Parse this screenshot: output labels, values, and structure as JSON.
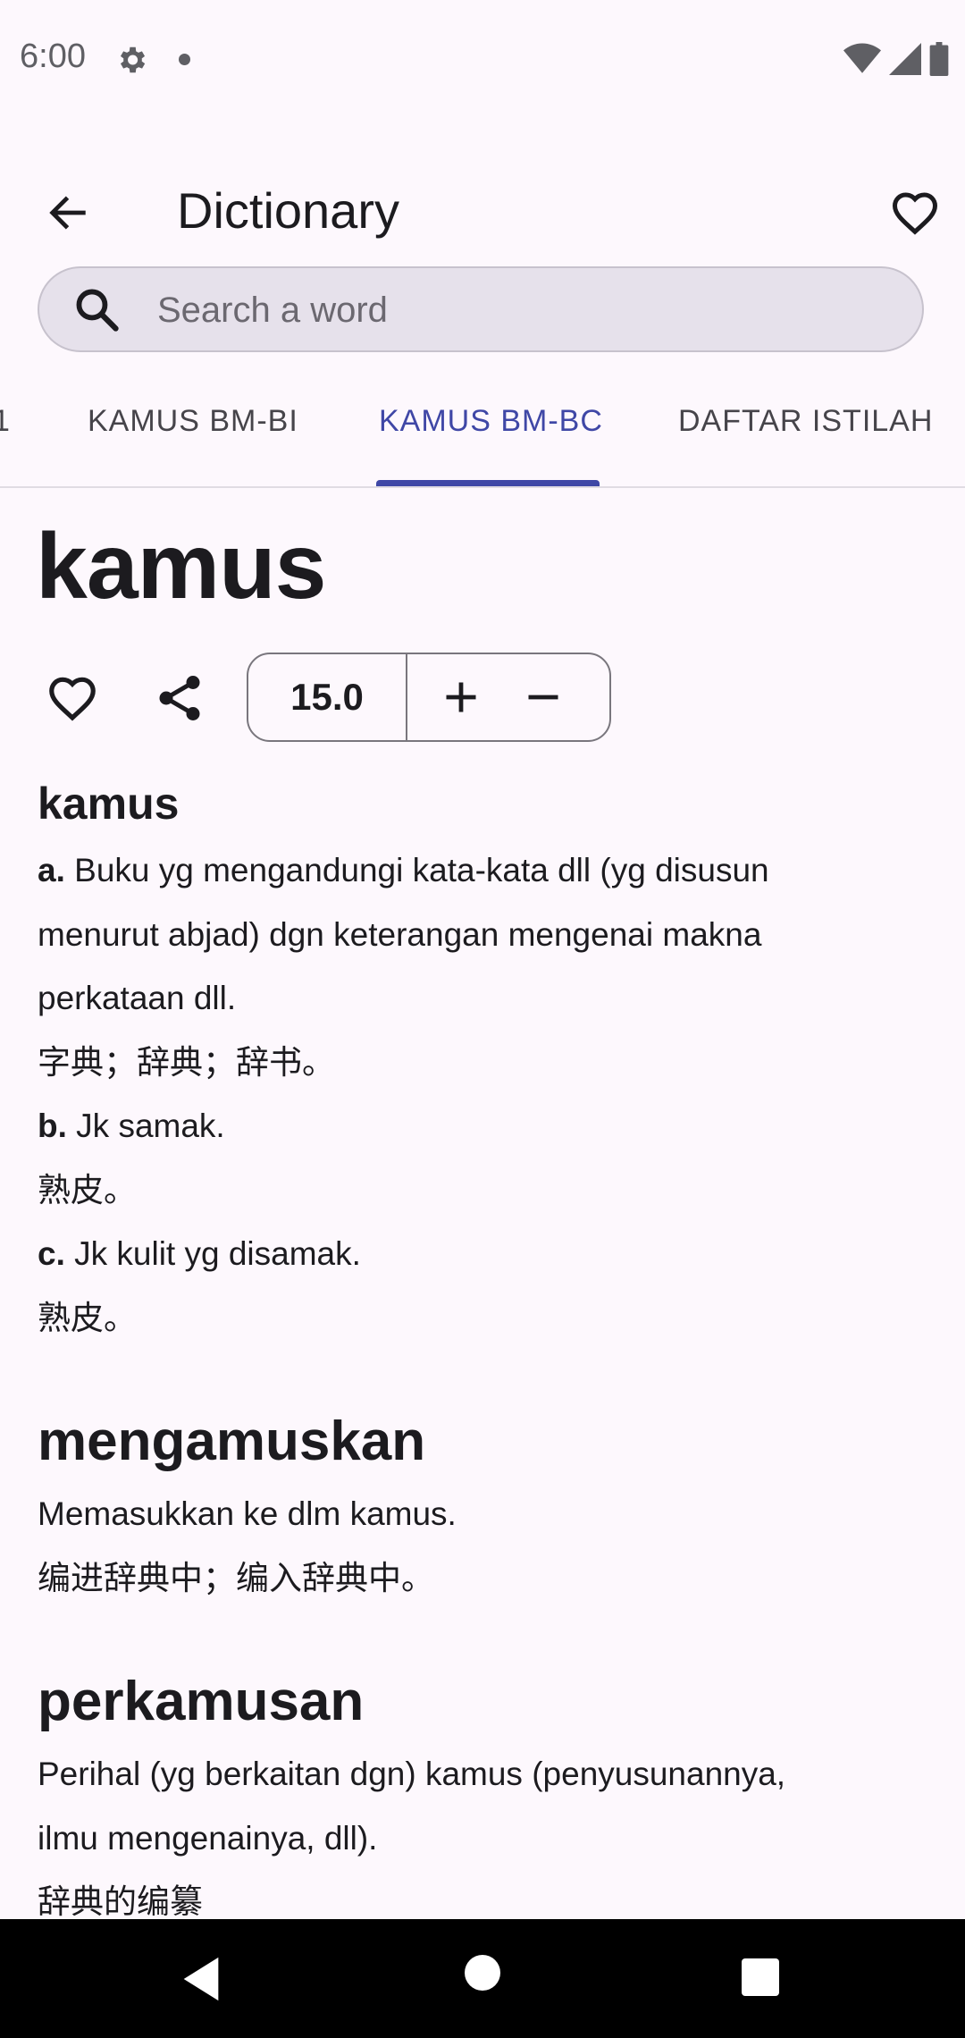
{
  "status_bar": {
    "time": "6:00"
  },
  "app_bar": {
    "title": "Dictionary"
  },
  "search": {
    "placeholder": "Search a word"
  },
  "tabs": [
    {
      "label": "KAMUS BM-BI",
      "active": false
    },
    {
      "label": "KAMUS BM-BC",
      "active": true
    },
    {
      "label": "DAFTAR ISTILAH",
      "active": false
    }
  ],
  "partial_tab_fragment": "1",
  "headword": "kamus",
  "font_size": "15.0",
  "entries": [
    {
      "title": "kamus",
      "lines": [
        {
          "marker": "a.",
          "text": " Buku yg mengandungi kata-kata dll (yg disusun"
        },
        {
          "marker": "",
          "text": "menurut abjad) dgn keterangan mengenai makna"
        },
        {
          "marker": "",
          "text": "perkataan dll."
        },
        {
          "marker": "",
          "text": "字典；辞典；辞书。"
        },
        {
          "marker": "b.",
          "text": " Jk samak."
        },
        {
          "marker": "",
          "text": "熟皮。"
        },
        {
          "marker": "c.",
          "text": " Jk kulit yg disamak."
        },
        {
          "marker": "",
          "text": "熟皮。"
        }
      ]
    },
    {
      "title": "mengamuskan",
      "lines": [
        {
          "marker": "",
          "text": "Memasukkan ke dlm kamus."
        },
        {
          "marker": "",
          "text": "编进辞典中；编入辞典中。"
        }
      ]
    },
    {
      "title": "perkamusan",
      "lines": [
        {
          "marker": "",
          "text": "Perihal (yg berkaitan dgn) kamus (penyusunannya,"
        },
        {
          "marker": "",
          "text": "ilmu mengenainya, dll)."
        },
        {
          "marker": "",
          "text": "辞典的编纂"
        }
      ]
    }
  ],
  "colors": {
    "accent": "#3F47A6",
    "background": "#FDF8FD",
    "search_bg": "#E6E1EB"
  },
  "icons": [
    "settings-icon",
    "wifi-icon",
    "signal-icon",
    "battery-icon",
    "back-arrow-icon",
    "heart-icon",
    "search-icon",
    "share-icon",
    "plus-icon",
    "minus-icon"
  ]
}
